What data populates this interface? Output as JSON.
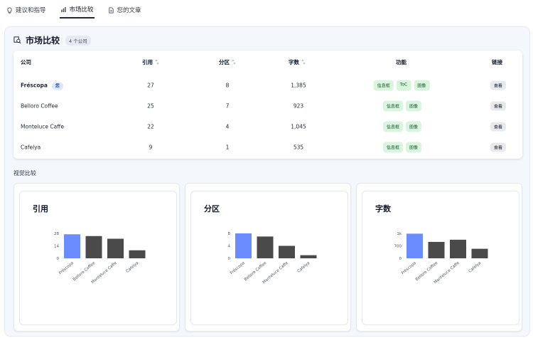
{
  "tabs": [
    {
      "label": "建议和指导",
      "icon": "lightbulb-icon",
      "active": false
    },
    {
      "label": "市场比较",
      "icon": "bar-chart-icon",
      "active": true
    },
    {
      "label": "您的文章",
      "icon": "document-icon",
      "active": false
    }
  ],
  "panel": {
    "title": "市场比较",
    "count_badge": "4 个公司"
  },
  "table": {
    "headers": {
      "company": "公司",
      "citations": "引用",
      "sections": "分区",
      "words": "字数",
      "features": "功能",
      "link": "链接"
    },
    "rows": [
      {
        "company": "Fréscopa",
        "you": "您",
        "citations": "27",
        "sections": "8",
        "words": "1,385",
        "features": [
          "信息框",
          "ToC",
          "图像"
        ],
        "link": "查看"
      },
      {
        "company": "Belloro Coffee",
        "you": "",
        "citations": "25",
        "sections": "7",
        "words": "923",
        "features": [
          "信息框",
          "图像"
        ],
        "link": "查看"
      },
      {
        "company": "Monteluce Caffe",
        "you": "",
        "citations": "22",
        "sections": "4",
        "words": "1,045",
        "features": [
          "信息框",
          "图像"
        ],
        "link": "查看"
      },
      {
        "company": "Cafelya",
        "you": "",
        "citations": "9",
        "sections": "1",
        "words": "535",
        "features": [
          "信息框",
          "图像"
        ],
        "link": "查看"
      }
    ]
  },
  "section_label": "视觉比较",
  "colors": {
    "highlight_bar": "#6b8cff",
    "default_bar": "#4a4a4a",
    "chip_bg": "#d9f5dd"
  },
  "chart_data": [
    {
      "type": "bar",
      "title": "引用",
      "categories": [
        "Fréscopa",
        "Belloro Coffee",
        "Monteluce Caffe",
        "Cafelya"
      ],
      "values": [
        27,
        25,
        22,
        9
      ],
      "yticks": [
        "0",
        "14",
        "28"
      ],
      "ylim": [
        0,
        28
      ],
      "highlight_index": 0
    },
    {
      "type": "bar",
      "title": "分区",
      "categories": [
        "Fréscopa",
        "Belloro Coffee",
        "Monteluce Caffe",
        "Cafelya"
      ],
      "values": [
        8,
        7,
        4,
        1
      ],
      "yticks": [
        "0",
        "4",
        "8"
      ],
      "ylim": [
        0,
        8
      ],
      "highlight_index": 0
    },
    {
      "type": "bar",
      "title": "字数",
      "categories": [
        "Fréscopa",
        "Belloro Coffee",
        "Monteluce Caffe",
        "Cafelya"
      ],
      "values": [
        1385,
        923,
        1045,
        535
      ],
      "yticks": [
        "0",
        "700",
        "1k"
      ],
      "ylim": [
        0,
        1400
      ],
      "highlight_index": 0
    }
  ]
}
